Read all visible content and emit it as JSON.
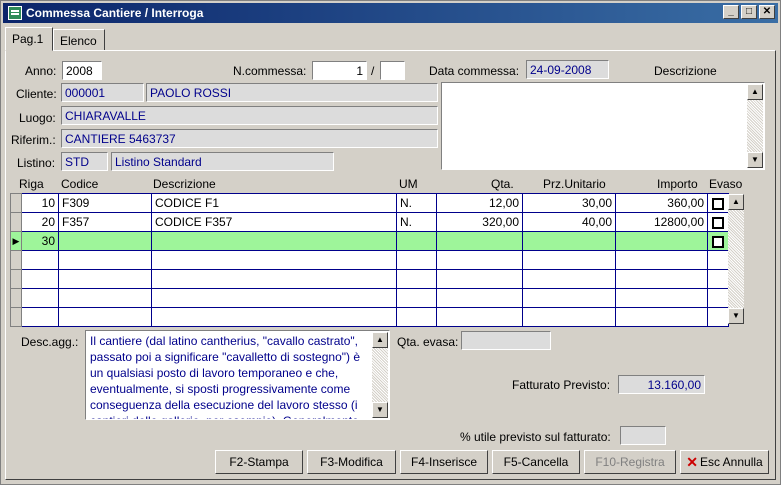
{
  "window": {
    "title": "Commessa Cantiere / Interroga",
    "minimize": "_",
    "maximize": "□",
    "close": "✕"
  },
  "tabs": [
    {
      "label": "Pag.1"
    },
    {
      "label": "Elenco"
    }
  ],
  "form": {
    "anno_label": "Anno:",
    "anno": "2008",
    "ncommessa_label": "N.commessa:",
    "ncommessa": "1",
    "ncommessa_sep": "/",
    "ncommessa_suffix": "",
    "data_label": "Data commessa:",
    "data": "24-09-2008",
    "descrizione_label": "Descrizione",
    "descrizione": "",
    "cliente_label": "Cliente:",
    "cliente_code": "000001",
    "cliente_name": "PAOLO ROSSI",
    "luogo_label": "Luogo:",
    "luogo": "CHIARAVALLE",
    "riferim_label": "Riferim.:",
    "riferim": "CANTIERE 5463737",
    "listino_label": "Listino:",
    "listino_code": "STD",
    "listino_name": "Listino Standard"
  },
  "grid": {
    "headers": {
      "riga": "Riga",
      "codice": "Codice",
      "descrizione": "Descrizione",
      "um": "UM",
      "qta": "Qta.",
      "prz": "Prz.Unitario",
      "importo": "Importo",
      "evaso": "Evaso"
    },
    "rows": [
      {
        "riga": "10",
        "codice": "F309",
        "descrizione": "CODICE F1",
        "um": "N.",
        "qta": "12,00",
        "prz": "30,00",
        "importo": "360,00"
      },
      {
        "riga": "20",
        "codice": "F357",
        "descrizione": "CODICE F357",
        "um": "N.",
        "qta": "320,00",
        "prz": "40,00",
        "importo": "12800,00"
      },
      {
        "riga": "30",
        "codice": "",
        "descrizione": "",
        "um": "",
        "qta": "",
        "prz": "",
        "importo": ""
      }
    ],
    "current_marker": "▶"
  },
  "bottom": {
    "desc_agg_label": "Desc.agg.:",
    "desc_agg": "Il cantiere (dal latino cantherius, \"cavallo castrato\", passato poi a significare \"cavalletto di sostegno\") è un qualsiasi posto di lavoro temporaneo e che, eventualmente, si sposti progressivamente come conseguenza della esecuzione del lavoro stesso (i cantieri delle gallerie, per esempio). Generalmente",
    "qta_evasa_label": "Qta. evasa:",
    "qta_evasa": "",
    "fatturato_label": "Fatturato Previsto:",
    "fatturato": "13.160,00",
    "utile_label": "% utile previsto sul fatturato:",
    "utile": ""
  },
  "buttons": {
    "stampa": "F2-Stampa",
    "modifica": "F3-Modifica",
    "inserisce": "F4-Inserisce",
    "cancella": "F5-Cancella",
    "registra": "F10-Registra",
    "esc": "Esc Annulla"
  }
}
